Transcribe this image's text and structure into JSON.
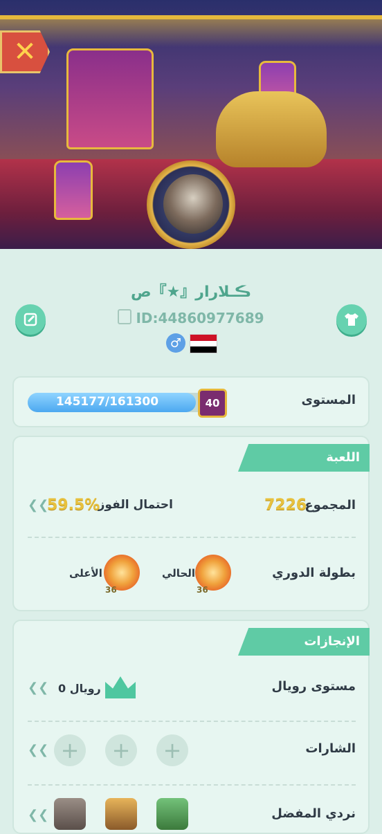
{
  "header": {
    "close_label": "✕"
  },
  "profile": {
    "name": "ڪـﻼرار『★』ص",
    "id_text": "ID:44860977689",
    "gender_symbol": "♂"
  },
  "level": {
    "label": "المستوى",
    "progress_text": "145177/161300",
    "progress_fraction": 0.9,
    "badge": "40"
  },
  "game": {
    "title": "اللعبة",
    "total_label": "المجموع",
    "total_value": "7226",
    "win_label": "احتمال الفوز",
    "win_value": "59.5%",
    "league_label": "بطولة الدوري",
    "current_label": "الحالي",
    "highest_label": "الأعلى",
    "medal_current_level": "36",
    "medal_highest_level": "36"
  },
  "achievements": {
    "title": "الإنجازات",
    "royal_label": "مستوى رويال",
    "royal_value": "رويال 0",
    "badges_label": "الشارات",
    "fav_dice_label": "نردي المفضل"
  },
  "icons": {
    "arrow": "❮❮",
    "plus": "+"
  },
  "colors": {
    "accent": "#5fcba5",
    "gold": "#e7c13e",
    "close": "#d8503f"
  }
}
